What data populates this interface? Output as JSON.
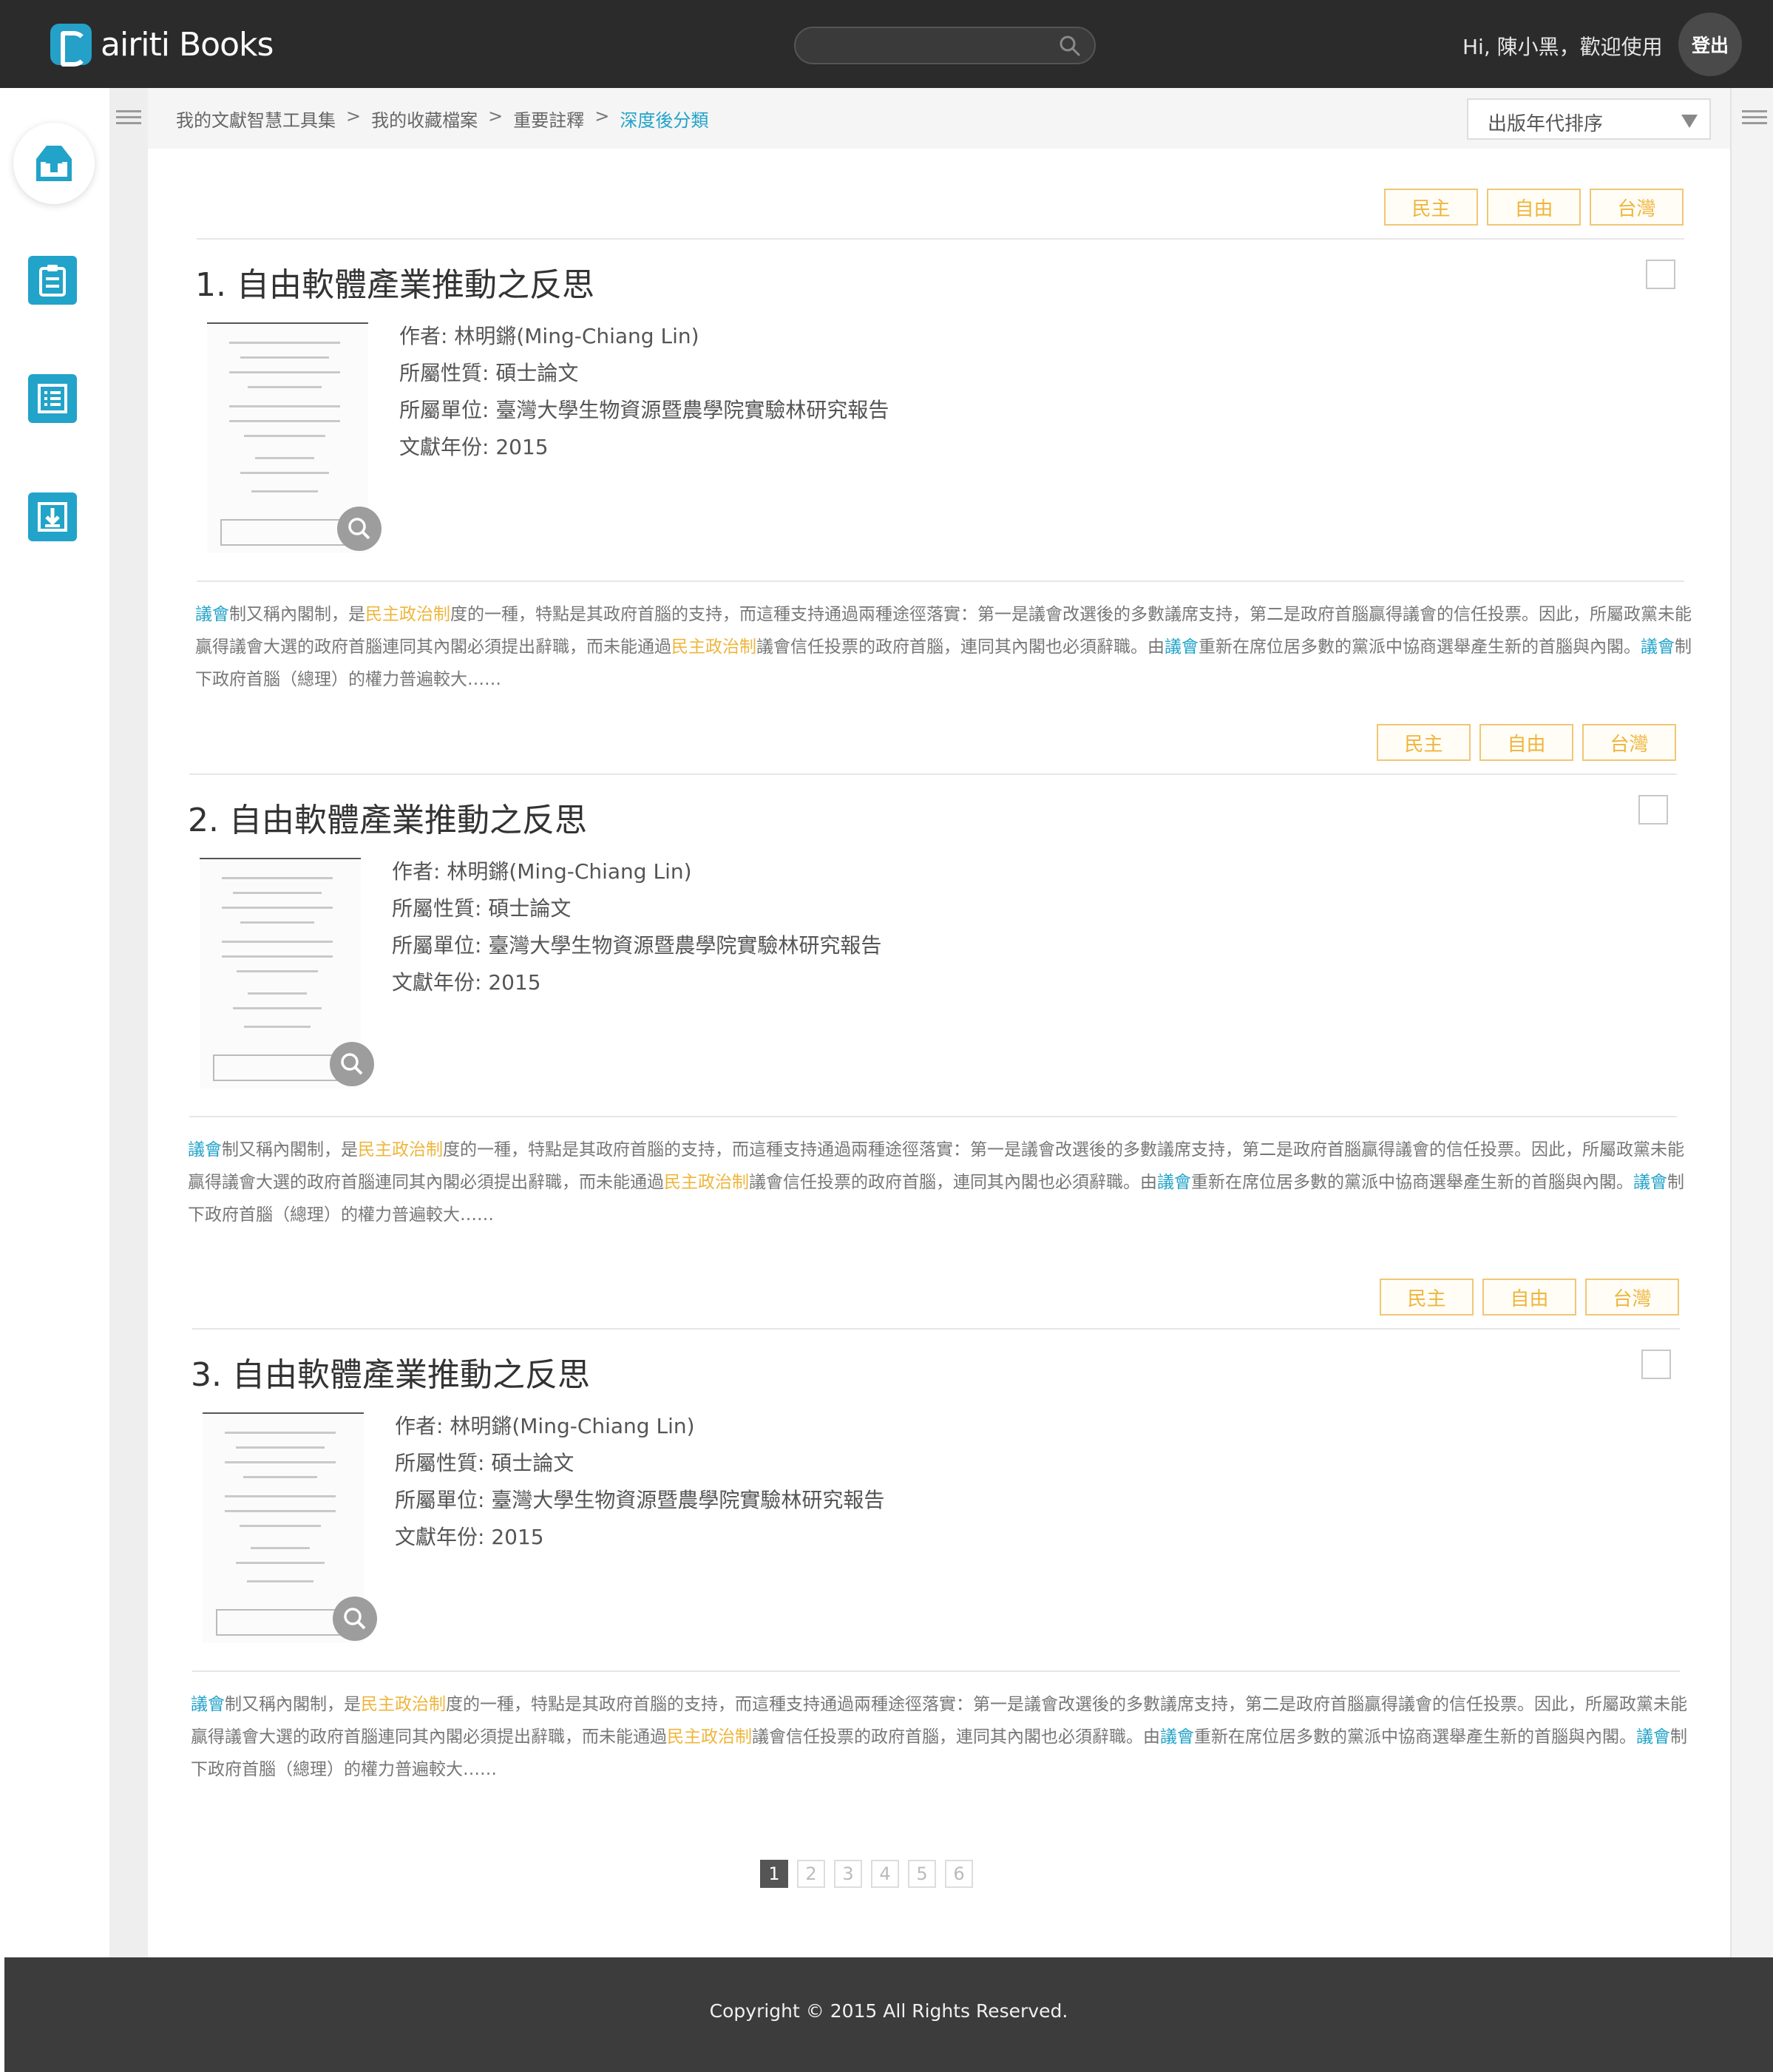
{
  "header": {
    "logo_text": "airiti Books",
    "search_placeholder": "",
    "greeting": "Hi, 陳小黑，歡迎使用",
    "logout_label": "登出"
  },
  "breadcrumb": {
    "items": [
      "我的文獻智慧工具集",
      "我的收藏檔案",
      "重要註釋",
      "深度後分類"
    ],
    "separator": ">"
  },
  "sort": {
    "selected": "出版年代排序"
  },
  "colors": {
    "accent": "#22a3c9",
    "tag": "#efb53c",
    "topbar": "#2b2b2b",
    "footer": "#3c3c3c"
  },
  "results": [
    {
      "tags": [
        "民主",
        "自由",
        "台灣"
      ],
      "title": "1. 自由軟體產業推動之反思",
      "author": "作者: 林明鏘(Ming-Chiang Lin)",
      "type": "所屬性質: 碩士論文",
      "unit": "所屬單位: 臺灣大學生物資源暨農學院實驗林研究報告",
      "year": "文獻年份: 2015",
      "abstract": {
        "kw1": "議會",
        "t1": "制又稱內閣制，是",
        "hl1": "民主政治制",
        "t2": "度的一種，特點是其政府首腦的支持，而這種支持通過兩種途徑落實：第一是議會改選後的多數議席支持，第二是政府首腦贏得議會的信任投票。因此，所屬政黨未能贏得議會大選的政府首腦連同其內閣必須提出辭職，而未能通過",
        "hl2": "民主政治制",
        "t3": "議會信任投票的政府首腦，連同其內閣也必須辭職。由",
        "kw2": "議會",
        "t4": "重新在席位居多數的黨派中協商選舉產生新的首腦與內閣。",
        "kw3": "議會",
        "t5": "制下政府首腦（總理）的權力普遍較大……"
      }
    },
    {
      "tags": [
        "民主",
        "自由",
        "台灣"
      ],
      "title": "2. 自由軟體產業推動之反思",
      "author": "作者: 林明鏘(Ming-Chiang Lin)",
      "type": "所屬性質: 碩士論文",
      "unit": "所屬單位: 臺灣大學生物資源暨農學院實驗林研究報告",
      "year": "文獻年份: 2015",
      "abstract": {
        "kw1": "議會",
        "t1": "制又稱內閣制，是",
        "hl1": "民主政治制",
        "t2": "度的一種，特點是其政府首腦的支持，而這種支持通過兩種途徑落實：第一是議會改選後的多數議席支持，第二是政府首腦贏得議會的信任投票。因此，所屬政黨未能贏得議會大選的政府首腦連同其內閣必須提出辭職，而未能通過",
        "hl2": "民主政治制",
        "t3": "議會信任投票的政府首腦，連同其內閣也必須辭職。由",
        "kw2": "議會",
        "t4": "重新在席位居多數的黨派中協商選舉產生新的首腦與內閣。",
        "kw3": "議會",
        "t5": "制下政府首腦（總理）的權力普遍較大……"
      }
    },
    {
      "tags": [
        "民主",
        "自由",
        "台灣"
      ],
      "title": "3. 自由軟體產業推動之反思",
      "author": "作者: 林明鏘(Ming-Chiang Lin)",
      "type": "所屬性質: 碩士論文",
      "unit": "所屬單位: 臺灣大學生物資源暨農學院實驗林研究報告",
      "year": "文獻年份: 2015",
      "abstract": {
        "kw1": "議會",
        "t1": "制又稱內閣制，是",
        "hl1": "民主政治制",
        "t2": "度的一種，特點是其政府首腦的支持，而這種支持通過兩種途徑落實：第一是議會改選後的多數議席支持，第二是政府首腦贏得議會的信任投票。因此，所屬政黨未能贏得議會大選的政府首腦連同其內閣必須提出辭職，而未能通過",
        "hl2": "民主政治制",
        "t3": "議會信任投票的政府首腦，連同其內閣也必須辭職。由",
        "kw2": "議會",
        "t4": "重新在席位居多數的黨派中協商選舉產生新的首腦與內閣。",
        "kw3": "議會",
        "t5": "制下政府首腦（總理）的權力普遍較大……"
      }
    }
  ],
  "pagination": {
    "pages": [
      "1",
      "2",
      "3",
      "4",
      "5",
      "6"
    ],
    "current": "1"
  },
  "footer": {
    "copyright": "Copyright © 2015 All Rights Reserved."
  }
}
